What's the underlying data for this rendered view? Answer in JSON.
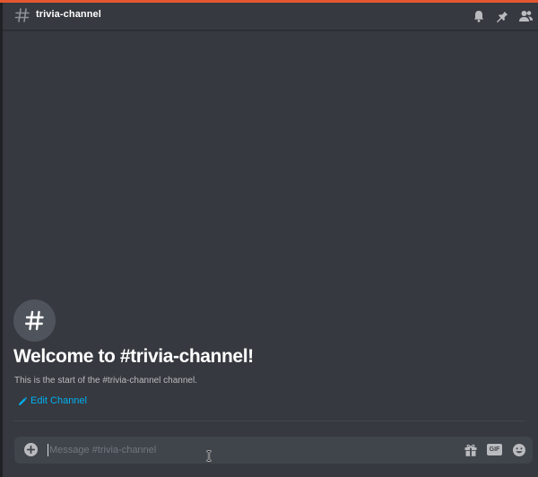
{
  "colors": {
    "background": "#36393f",
    "accent_top": "#e4572e",
    "link": "#00b0f4",
    "icon": "#b9bbbe",
    "composer": "#40444b"
  },
  "header": {
    "channel_name": "trivia-channel",
    "icons": [
      "hash-icon",
      "bell-icon",
      "pin-icon",
      "members-icon"
    ]
  },
  "welcome": {
    "title": "Welcome to #trivia-channel!",
    "subtitle": "This is the start of the #trivia-channel channel.",
    "edit_link": "Edit Channel"
  },
  "composer": {
    "placeholder": "Message #trivia-channel",
    "value": "",
    "gif_label": "GIF",
    "icons": [
      "plus-circle-icon",
      "gift-icon",
      "gif-icon",
      "emoji-icon"
    ]
  }
}
